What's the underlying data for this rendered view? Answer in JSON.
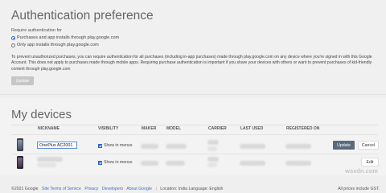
{
  "auth": {
    "title": "Authentication preference",
    "subtitle": "Require authentication for",
    "options": [
      {
        "label": "Purchases and app installs through play.google.com",
        "selected": true
      },
      {
        "label": "Only app installs through play.google.com",
        "selected": false
      }
    ],
    "description": "To prevent unauthorized purchases, you can require authentication for all purchases (including in-app purchases) made through play.google.com on any device where you're signed in with this Google Account. This does not apply to purchases made through mobile apps. Requiring purchase authentication is important if you share your devices with others or want to prevent purchases of kid-friendly content through play.google.com",
    "update_label": "Update"
  },
  "devices": {
    "title": "My devices",
    "columns": [
      "NICKNAME",
      "VISIBILITY",
      "MAKER",
      "MODEL",
      "CARRIER",
      "LAST USED",
      "REGISTERED ON"
    ],
    "rows": [
      {
        "nickname": "OnePlus AC2001",
        "visibility": "Show in menus",
        "buttons": [
          "Update",
          "Cancel"
        ]
      },
      {
        "nickname": "",
        "visibility": "Show in menus",
        "buttons": [
          "Edit"
        ]
      }
    ]
  },
  "footer": {
    "copyright": "©2021 Google",
    "links": [
      "Site Terms of Service",
      "Privacy",
      "Developers",
      "About Google"
    ],
    "location": "Location: India",
    "language": "Language: English",
    "prices_note": "All prices include GST."
  },
  "watermark": "wsxdn.com",
  "colors": {
    "accent": "#2a64d0",
    "update_button": "#5a6b7d",
    "link": "#3a6fc9"
  }
}
